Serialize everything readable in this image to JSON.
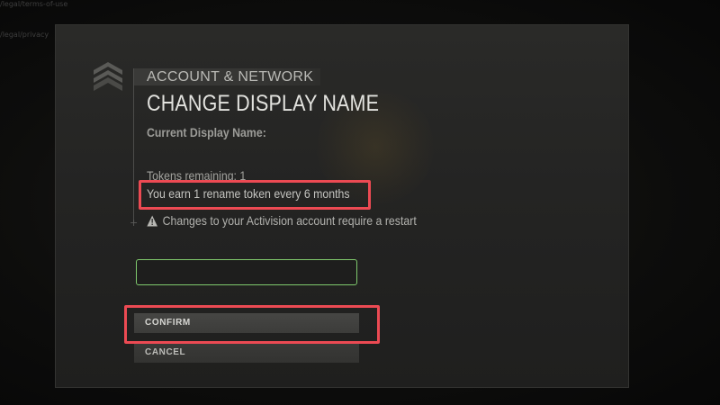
{
  "background": {
    "top_text": "/legal/terms-of-use",
    "side_text": "/legal/privacy"
  },
  "dialog": {
    "breadcrumb": "ACCOUNT & NETWORK",
    "title": "CHANGE DISPLAY NAME",
    "current_name_label": "Current Display Name:",
    "tokens_remaining": "Tokens remaining: 1",
    "rename_info": "You earn 1 rename token every 6 months",
    "restart_warning": "Changes to your Activision account require a restart",
    "name_input": {
      "value": "",
      "placeholder": ""
    },
    "confirm_label": "CONFIRM",
    "cancel_label": "CANCEL"
  },
  "colors": {
    "highlight": "#ec4a53",
    "input_border": "#7fc96d",
    "panel": "#262625",
    "text_primary": "#e2e2de"
  },
  "icons": {
    "logo": "chevron-stack-logo-icon",
    "warning": "warning-triangle-icon"
  }
}
